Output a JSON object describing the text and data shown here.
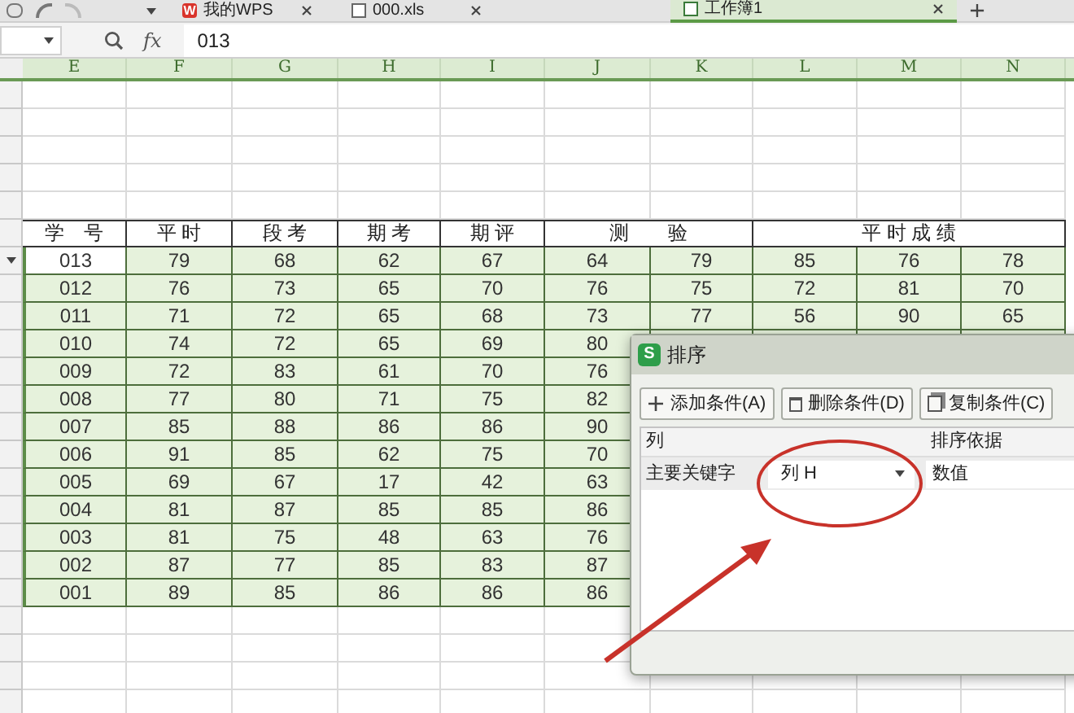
{
  "tabs": [
    {
      "label": "我的WPS",
      "selected": false,
      "kind": "home",
      "icon_text": "W"
    },
    {
      "label": "000.xls",
      "selected": false,
      "kind": "file"
    },
    {
      "label": "工作簿1",
      "selected": true,
      "kind": "file"
    }
  ],
  "formula_bar": {
    "fx": "fx",
    "value": "013"
  },
  "column_headers": [
    "E",
    "F",
    "G",
    "H",
    "I",
    "J",
    "K",
    "L",
    "M",
    "N"
  ],
  "table": {
    "header": [
      {
        "text": "学　号",
        "kind": "single"
      },
      {
        "text": "平 时",
        "kind": "single"
      },
      {
        "text": "段 考",
        "kind": "single"
      },
      {
        "text": "期 考",
        "kind": "single"
      },
      {
        "text": "期 评",
        "kind": "single"
      },
      {
        "text": "测　　验",
        "kind": "double"
      },
      {
        "text": "平 时 成 绩",
        "kind": "triple"
      }
    ],
    "rows": [
      {
        "selected": true,
        "cells": [
          "013",
          "79",
          "68",
          "62",
          "67",
          "64",
          "79",
          "85",
          "76",
          "78"
        ]
      },
      {
        "selected": false,
        "cells": [
          "012",
          "76",
          "73",
          "65",
          "70",
          "76",
          "75",
          "72",
          "81",
          "70"
        ]
      },
      {
        "selected": false,
        "cells": [
          "011",
          "71",
          "72",
          "65",
          "68",
          "73",
          "77",
          "56",
          "90",
          "65"
        ]
      },
      {
        "selected": false,
        "cells": [
          "010",
          "74",
          "72",
          "65",
          "69",
          "80"
        ]
      },
      {
        "selected": false,
        "cells": [
          "009",
          "72",
          "83",
          "61",
          "70",
          "76"
        ]
      },
      {
        "selected": false,
        "cells": [
          "008",
          "77",
          "80",
          "71",
          "75",
          "82"
        ]
      },
      {
        "selected": false,
        "cells": [
          "007",
          "85",
          "88",
          "86",
          "86",
          "90"
        ]
      },
      {
        "selected": false,
        "cells": [
          "006",
          "91",
          "85",
          "62",
          "75",
          "70"
        ]
      },
      {
        "selected": false,
        "cells": [
          "005",
          "69",
          "67",
          "17",
          "42",
          "63"
        ]
      },
      {
        "selected": false,
        "cells": [
          "004",
          "81",
          "87",
          "85",
          "85",
          "86"
        ]
      },
      {
        "selected": false,
        "cells": [
          "003",
          "81",
          "75",
          "48",
          "63",
          "76"
        ]
      },
      {
        "selected": false,
        "cells": [
          "002",
          "87",
          "77",
          "85",
          "83",
          "87"
        ]
      },
      {
        "selected": false,
        "cells": [
          "001",
          "89",
          "85",
          "86",
          "86",
          "86"
        ]
      }
    ]
  },
  "dialog": {
    "icon": "S",
    "title": "排序",
    "buttons": [
      {
        "label": "添加条件(A)",
        "kind": "add"
      },
      {
        "label": "删除条件(D)",
        "kind": "delete"
      },
      {
        "label": "复制条件(C)",
        "kind": "copy"
      }
    ],
    "columns": [
      "列",
      "排序依据"
    ],
    "rows": [
      {
        "label": "主要关键字",
        "column": "列 H",
        "sort_on": "数值"
      }
    ]
  }
}
